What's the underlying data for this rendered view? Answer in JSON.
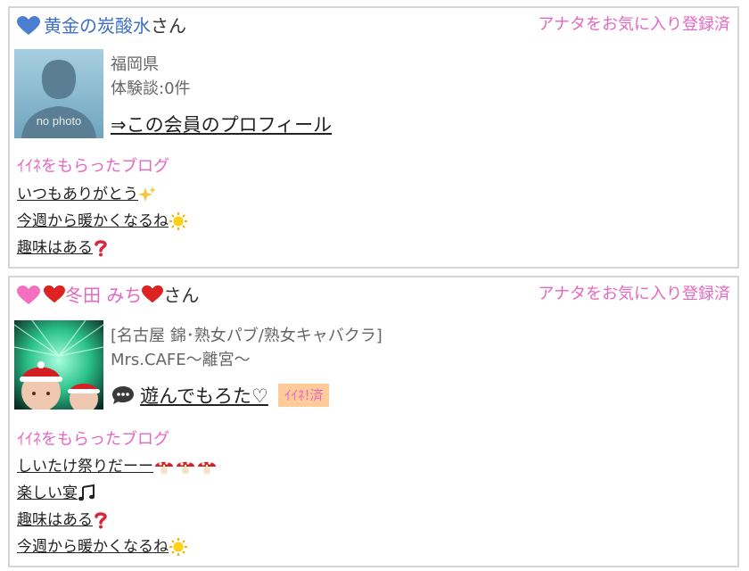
{
  "cards": [
    {
      "name": "黄金の炭酸水",
      "suffix": "さん",
      "favorite_status": "アナタをお気に入り登録済",
      "heart_color": "#4a7fd0",
      "name_color": "#3d6fc6",
      "photo_watermark": "no photo",
      "prefecture": "福岡県",
      "experience": "体験談:0件",
      "profile_link": "⇒この会員のプロフィール",
      "section_title": "ｲｲﾈをもらったブログ",
      "blogs": [
        {
          "title": "いつもありがとう",
          "emoji": "sparkles-icon"
        },
        {
          "title": "今週から暖かくなるね",
          "emoji": "sun-icon"
        },
        {
          "title": "趣味はある",
          "emoji": "question-icon"
        }
      ]
    },
    {
      "name": "冬田 みち",
      "suffix": "さん",
      "favorite_status": "アナタをお気に入り登録済",
      "heart_color": "#f46fc0",
      "name_color": "#e667c0",
      "shop_line1": "[名古屋 錦･熟女パブ/熟女キャバクラ]",
      "shop_line2": "Mrs.CAFE〜離宮〜",
      "comment_link": "遊んでもろた♡",
      "like_badge": "ｲｲﾈ!済",
      "section_title": "ｲｲﾈをもらったブログ",
      "blogs": [
        {
          "title": "しいたけ祭りだーー",
          "emoji": "mushroom-icon"
        },
        {
          "title": "楽しい宴",
          "emoji": "music-notes-icon"
        },
        {
          "title": "趣味はある",
          "emoji": "question-icon"
        },
        {
          "title": "今週から暖かくなるね",
          "emoji": "sun-icon"
        }
      ]
    }
  ],
  "colors": {
    "accent": "#e667c0",
    "badge_bg": "#ffcc99",
    "border": "#d6d6d6"
  }
}
